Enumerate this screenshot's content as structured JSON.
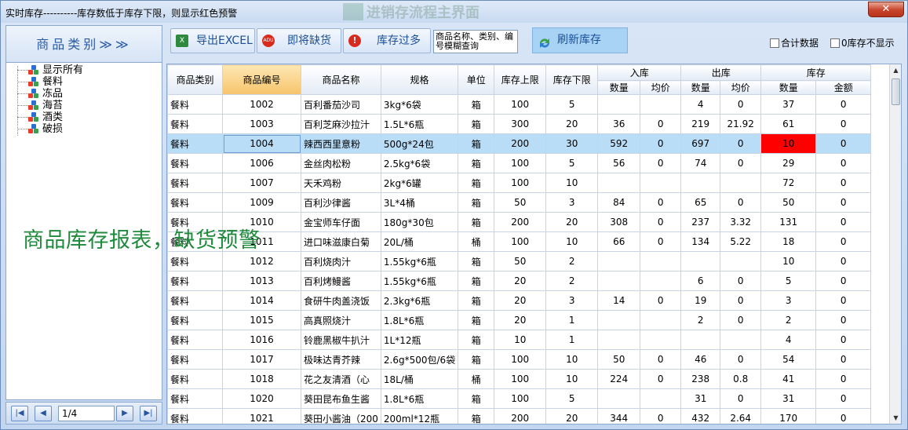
{
  "window": {
    "title": "实时库存----------库存数低于库存下限，则显示红色预警",
    "ghost_title": "进销存流程主界面",
    "close_label": "✕"
  },
  "sidebar": {
    "header": "商品类别≫≫",
    "tree": [
      {
        "label": "显示所有"
      },
      {
        "label": "餐料"
      },
      {
        "label": "冻品"
      },
      {
        "label": "海苔"
      },
      {
        "label": "酒类"
      },
      {
        "label": "破损"
      }
    ],
    "pager": {
      "first": "|◀",
      "prev": "◀",
      "page_value": "1/4",
      "next": "▶",
      "last": "▶|"
    }
  },
  "toolbar": {
    "export_label": "导出EXCEL",
    "shortage_label": "即将缺货",
    "overstock_label": "库存过多",
    "search_placeholder": "商品名称、类别、编号模糊查询",
    "refresh_label": "刷新库存",
    "sum_label": "合计数据",
    "zero_hide_label": "0库存不显示"
  },
  "grid": {
    "headers": {
      "category": "商品类别",
      "code": "商品编号",
      "name": "商品名称",
      "spec": "规格",
      "unit": "单位",
      "upper": "库存上限",
      "lower": "库存下限",
      "in": "入库",
      "out": "出库",
      "stock": "库存",
      "qty": "数量",
      "avg": "均价",
      "amount": "金额"
    },
    "rows": [
      [
        "餐料",
        "1002",
        "百利番茄沙司",
        "3kg*6袋",
        "箱",
        "100",
        "5",
        "",
        "",
        "4",
        "0",
        "37",
        "0"
      ],
      [
        "餐料",
        "1003",
        "百利芝麻沙拉汁",
        "1.5L*6瓶",
        "箱",
        "300",
        "20",
        "36",
        "0",
        "219",
        "21.92",
        "61",
        "0"
      ],
      [
        "餐料",
        "1004",
        "辣西西里意粉",
        "500g*24包",
        "箱",
        "200",
        "30",
        "592",
        "0",
        "697",
        "0",
        "10",
        "0"
      ],
      [
        "餐料",
        "1006",
        "金丝肉松粉",
        "2.5kg*6袋",
        "箱",
        "100",
        "5",
        "56",
        "0",
        "74",
        "0",
        "29",
        "0"
      ],
      [
        "餐料",
        "1007",
        "天禾鸡粉",
        "2kg*6罐",
        "箱",
        "100",
        "10",
        "",
        "",
        "",
        "",
        "72",
        "0"
      ],
      [
        "餐料",
        "1009",
        "百利沙律酱",
        "3L*4桶",
        "箱",
        "50",
        "3",
        "84",
        "0",
        "65",
        "0",
        "50",
        "0"
      ],
      [
        "餐料",
        "1010",
        "金宝师车仔面",
        "180g*30包",
        "箱",
        "200",
        "20",
        "308",
        "0",
        "237",
        "3.32",
        "131",
        "0"
      ],
      [
        "餐料",
        "1011",
        "进口味滋康白菊",
        "20L/桶",
        "桶",
        "100",
        "10",
        "66",
        "0",
        "134",
        "5.22",
        "18",
        "0"
      ],
      [
        "餐料",
        "1012",
        "百利烧肉汁",
        "1.55kg*6瓶",
        "箱",
        "50",
        "2",
        "",
        "",
        "",
        "",
        "10",
        "0"
      ],
      [
        "餐料",
        "1013",
        "百利烤鳗酱",
        "1.55kg*6瓶",
        "箱",
        "20",
        "2",
        "",
        "",
        "6",
        "0",
        "5",
        "0"
      ],
      [
        "餐料",
        "1014",
        "食研牛肉盖浇饭",
        "2.3kg*6瓶",
        "箱",
        "20",
        "3",
        "14",
        "0",
        "19",
        "0",
        "3",
        "0"
      ],
      [
        "餐料",
        "1015",
        "高真照烧汁",
        "1.8L*6瓶",
        "箱",
        "20",
        "1",
        "",
        "",
        "2",
        "0",
        "2",
        "0"
      ],
      [
        "餐料",
        "1016",
        "铃鹿黑椒牛扒汁",
        "1L*12瓶",
        "箱",
        "10",
        "1",
        "",
        "",
        "",
        "",
        "4",
        "0"
      ],
      [
        "餐料",
        "1017",
        "极味达青芥辣",
        "2.6g*500包/6袋",
        "箱",
        "100",
        "10",
        "50",
        "0",
        "46",
        "0",
        "54",
        "0"
      ],
      [
        "餐料",
        "1018",
        "花之友清酒（心",
        "18L/桶",
        "桶",
        "100",
        "10",
        "224",
        "0",
        "238",
        "0.8",
        "41",
        "0"
      ],
      [
        "餐料",
        "1020",
        "葵田昆布鱼生酱",
        "1.8L*6瓶",
        "箱",
        "100",
        "5",
        "",
        "",
        "31",
        "0",
        "31",
        "0"
      ],
      [
        "餐料",
        "1021",
        "葵田小酱油（200",
        "200ml*12瓶",
        "箱",
        "200",
        "20",
        "344",
        "0",
        "432",
        "2.64",
        "170",
        "0"
      ]
    ],
    "selected_row": 2,
    "warning_color": "#ff0000"
  },
  "overlay_caption": "商品库存报表，缺货预警"
}
